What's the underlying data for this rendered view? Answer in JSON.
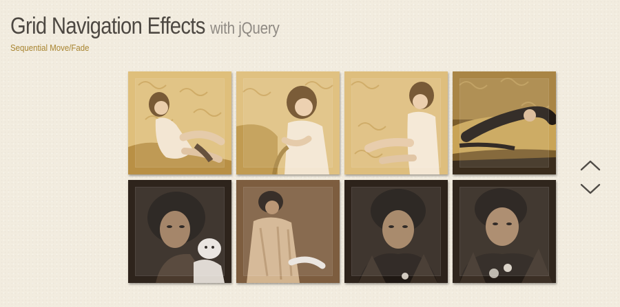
{
  "header": {
    "title": "Grid Navigation Effects",
    "title_suffix": "with jQuery",
    "subtitle": "Sequential Move/Fade"
  },
  "grid": {
    "tiles": [
      {
        "palette": "light-gold"
      },
      {
        "palette": "light-gold"
      },
      {
        "palette": "light-gold"
      },
      {
        "palette": "dark-gold"
      },
      {
        "palette": "dark-brown"
      },
      {
        "palette": "mid-brown"
      },
      {
        "palette": "dark-brown"
      },
      {
        "palette": "dark-brown"
      }
    ]
  },
  "navigation": {
    "up_icon": "chevron-up-icon",
    "down_icon": "chevron-down-icon"
  },
  "colors": {
    "background": "#f2ecdf",
    "title": "#4d4842",
    "title_suffix": "#8f8a83",
    "subtitle": "#a8842f",
    "gold_light": "#e2c37e",
    "gold_dark": "#5b4621",
    "brown_dark": "#2b2119",
    "brown_mid": "#6f5436",
    "arrow": "#4f4b46"
  }
}
